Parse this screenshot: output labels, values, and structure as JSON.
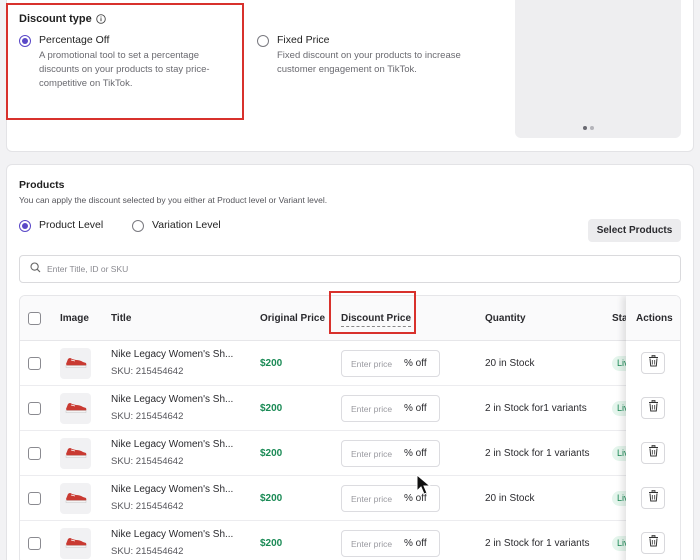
{
  "discount_type": {
    "title": "Discount type",
    "options": [
      {
        "label": "Percentage Off",
        "description": "A promotional tool to set a percentage discounts on your products to stay price-competitive on TikTok.",
        "selected": true
      },
      {
        "label": "Fixed Price",
        "description": "Fixed discount on your products to increase customer engagement on TikTok.",
        "selected": false
      }
    ]
  },
  "products": {
    "title": "Products",
    "subtitle": "You can apply the discount selected by you either at Product level or Variant level.",
    "levels": [
      {
        "label": "Product Level",
        "selected": true
      },
      {
        "label": "Variation Level",
        "selected": false
      }
    ],
    "select_button": "Select Products",
    "search_placeholder": "Enter Title, ID or SKU",
    "columns": {
      "image": "Image",
      "title": "Title",
      "original_price": "Original Price",
      "discount_price": "Discount Price",
      "quantity": "Quantity",
      "status": "Sta",
      "actions": "Actions"
    },
    "rows": [
      {
        "title": "Nike Legacy Women's Sh...",
        "sku": "SKU: 215454642",
        "price": "$200",
        "discount_placeholder": "Enter price",
        "suffix": "% off",
        "quantity": "20 in Stock",
        "status": "Live"
      },
      {
        "title": "Nike Legacy Women's Sh...",
        "sku": "SKU: 215454642",
        "price": "$200",
        "discount_placeholder": "Enter price",
        "suffix": "% off",
        "quantity": "2 in Stock for1 variants",
        "status": "Live"
      },
      {
        "title": "Nike Legacy Women's Sh...",
        "sku": "SKU: 215454642",
        "price": "$200",
        "discount_placeholder": "Enter price",
        "suffix": "% off",
        "quantity": "2 in Stock for 1 variants",
        "status": "Live"
      },
      {
        "title": "Nike Legacy Women's Sh...",
        "sku": "SKU: 215454642",
        "price": "$200",
        "discount_placeholder": "Enter price",
        "suffix": "% off",
        "quantity": "20 in Stock",
        "status": "Live"
      },
      {
        "title": "Nike Legacy Women's Sh...",
        "sku": "SKU: 215454642",
        "price": "$200",
        "discount_placeholder": "Enter price",
        "suffix": "% off",
        "quantity": "2 in Stock for 1 variants",
        "status": "Live"
      }
    ]
  },
  "colors": {
    "accent": "#5a48c7",
    "price": "#1a8a55",
    "highlight": "#d8312c"
  },
  "icons": {
    "info": "info-icon",
    "search": "search-icon",
    "trash": "trash-icon",
    "shoe": "sneaker-icon"
  }
}
